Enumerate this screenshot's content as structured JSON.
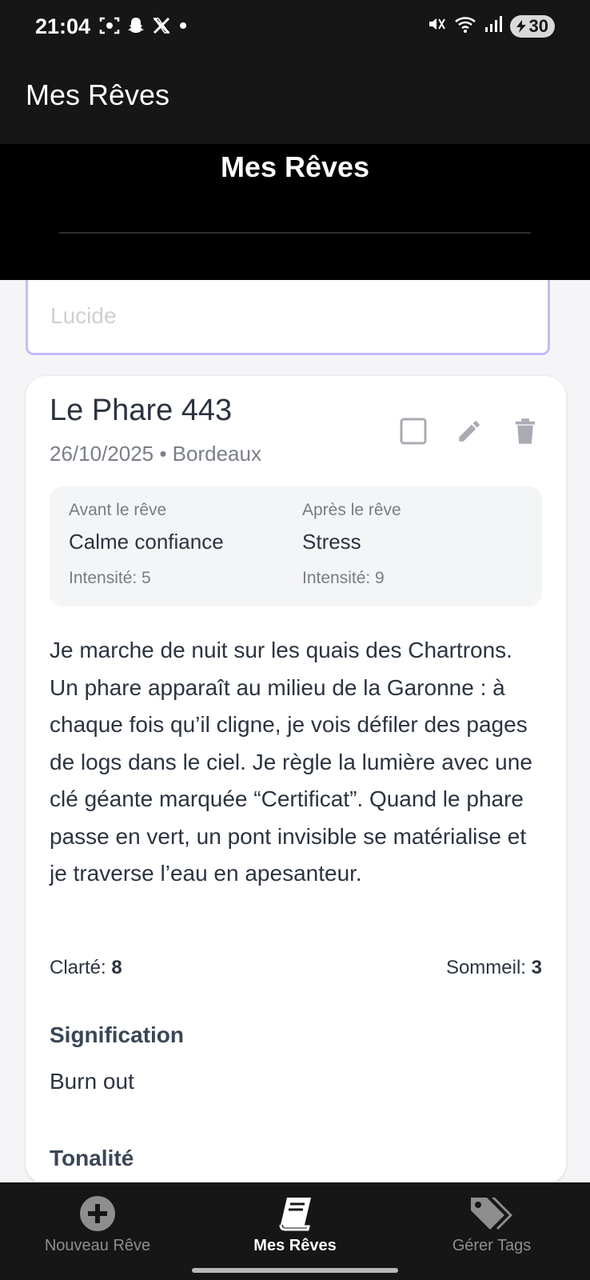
{
  "status_bar": {
    "time": "21:04",
    "battery": "30",
    "left_icons": [
      "screenshot-icon",
      "snapchat-icon",
      "x-icon",
      "dot-icon"
    ],
    "right_icons": [
      "mute-icon",
      "wifi-icon",
      "signal-icon",
      "battery-icon"
    ]
  },
  "app_bar": {
    "title": "Mes Rêves"
  },
  "header": {
    "title": "Mes Rêves"
  },
  "filter": {
    "value": "Lucide"
  },
  "dream": {
    "title": "Le Phare 443",
    "subtitle": "26/10/2025 • Bordeaux",
    "before": {
      "label": "Avant le rêve",
      "value": "Calme confiance",
      "intensity": "Intensité: 5"
    },
    "after": {
      "label": "Après le rêve",
      "value": "Stress",
      "intensity": "Intensité: 9"
    },
    "text": "Je marche de nuit sur les quais des Chartrons. Un phare apparaît au milieu de la Garonne : à chaque fois qu’il cligne, je vois défiler des pages de logs dans le ciel. Je règle la lumière avec une clé géante marquée “Certificat”. Quand le phare passe en vert, un pont invisible se matérialise et je traverse l’eau en apesanteur.",
    "clarity_label": "Clarté: ",
    "clarity_value": "8",
    "sleep_label": "Sommeil: ",
    "sleep_value": "3",
    "meaning_heading": "Signification",
    "meaning_value": "Burn out",
    "tone_heading": "Tonalité"
  },
  "nav": {
    "items": [
      {
        "label": "Nouveau Rêve",
        "icon": "plus-circle-icon",
        "active": false
      },
      {
        "label": "Mes Rêves",
        "icon": "book-icon",
        "active": true
      },
      {
        "label": "Gérer Tags",
        "icon": "tags-icon",
        "active": false
      }
    ]
  },
  "colors": {
    "status_bg": "#161616",
    "header_bg": "#000000",
    "accent_border": "#c8b9f5",
    "text_primary": "#2b3440",
    "nav_active": "#ffffff",
    "nav_inactive": "#8e8e8e"
  }
}
